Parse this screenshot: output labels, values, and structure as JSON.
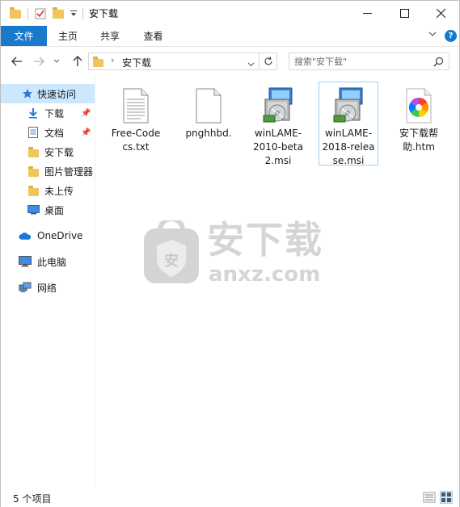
{
  "window": {
    "title": "安下载",
    "minimize_icon": "minimize-icon",
    "maximize_icon": "maximize-icon",
    "close_icon": "close-icon"
  },
  "ribbon": {
    "tabs": [
      "文件",
      "主页",
      "共享",
      "查看"
    ],
    "accent_color": "#1979ca"
  },
  "navigation": {
    "breadcrumb": [
      "安下载"
    ],
    "search_placeholder": "搜索\"安下载\""
  },
  "sidebar": {
    "quick_access": "快速访问",
    "items": [
      {
        "label": "下载",
        "icon": "download-arrow-icon",
        "pinned": true
      },
      {
        "label": "文档",
        "icon": "document-icon",
        "pinned": true
      },
      {
        "label": "安下载",
        "icon": "folder-icon",
        "pinned": false
      },
      {
        "label": "图片管理器",
        "icon": "folder-icon",
        "pinned": false
      },
      {
        "label": "未上传",
        "icon": "folder-icon",
        "pinned": false
      },
      {
        "label": "桌面",
        "icon": "desktop-icon",
        "pinned": false
      }
    ],
    "onedrive": "OneDrive",
    "this_pc": "此电脑",
    "network": "网络"
  },
  "files": [
    {
      "name": "Free-Codecs.txt",
      "lines": [
        "Free-Code",
        "cs.txt"
      ],
      "icon": "text-file-icon",
      "selected": false
    },
    {
      "name": "pnghhbd.",
      "lines": [
        "pnghhbd."
      ],
      "icon": "blank-file-icon",
      "selected": false
    },
    {
      "name": "winLAME-2010-beta2.msi",
      "lines": [
        "winLAME-",
        "2010-beta",
        "2.msi"
      ],
      "icon": "msi-installer-icon",
      "selected": false
    },
    {
      "name": "winLAME-2018-release.msi",
      "lines": [
        "winLAME-",
        "2018-relea",
        "se.msi"
      ],
      "icon": "msi-installer-icon",
      "selected": true
    },
    {
      "name": "安下载帮助.htm",
      "lines": [
        "安下载帮",
        "助.htm"
      ],
      "icon": "html-file-icon",
      "selected": false
    }
  ],
  "watermark": {
    "title": "安下载",
    "domain": "anxz.com",
    "badge": "安"
  },
  "statusbar": {
    "count_text": "5 个项目"
  }
}
